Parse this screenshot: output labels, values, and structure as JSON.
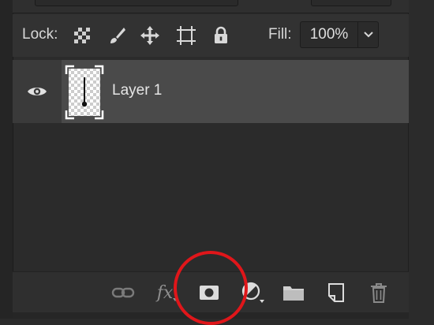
{
  "lock": {
    "label": "Lock:",
    "icons": [
      "lock-transparent-pixels-icon",
      "lock-image-pixels-icon",
      "lock-position-icon",
      "lock-artboard-icon",
      "lock-all-icon"
    ]
  },
  "fill": {
    "label": "Fill:",
    "value": "100%"
  },
  "layers": [
    {
      "name": "Layer 1",
      "visible": true
    }
  ],
  "bottom_toolbar": {
    "fx_label": "fx",
    "icons": [
      "link-layers-icon",
      "fx-icon",
      "add-layer-mask-icon",
      "adjustment-layer-icon",
      "new-group-icon",
      "new-layer-icon",
      "delete-layer-icon"
    ]
  },
  "colors": {
    "panel_bg": "#2b2b2b",
    "selected_layer": "#4a4a4a",
    "annotation": "#e0161a"
  }
}
